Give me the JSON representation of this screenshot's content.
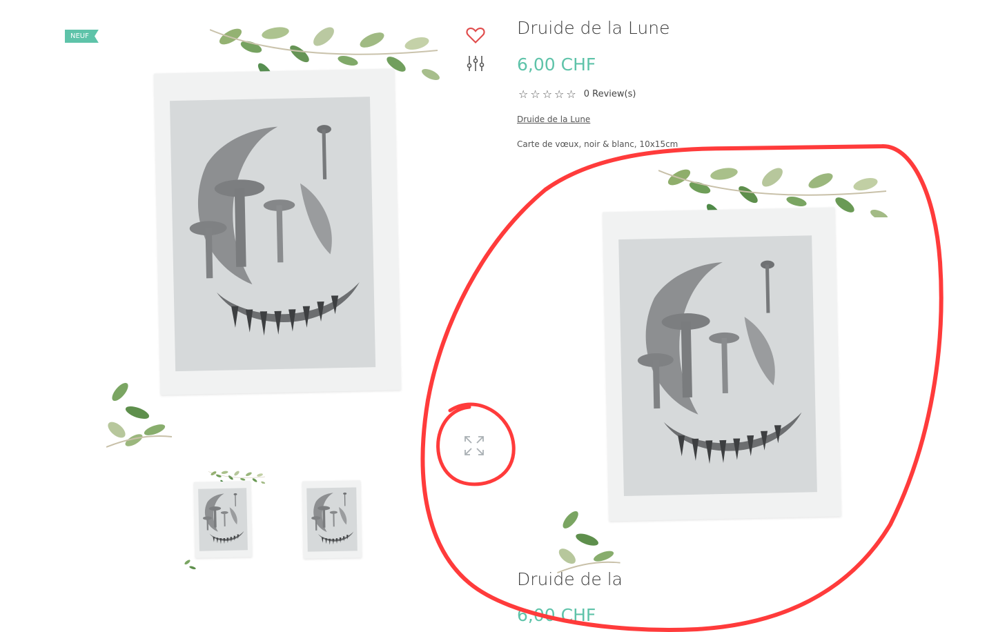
{
  "badge": {
    "label": "NEUF"
  },
  "product": {
    "title": "Druide de la Lune",
    "price": "6,00 CHF",
    "rating": {
      "value": 0,
      "max": 5,
      "reviews_label": "0 Review(s)"
    },
    "link_label": "Druide de la Lune",
    "description": "Carte de vœux, noir & blanc, 10x15cm"
  },
  "zoom_panel": {
    "title": "Druide de la",
    "price": "6,00 CHF"
  },
  "icons": {
    "wishlist": "heart-icon",
    "compare": "sliders-icon",
    "expand": "expand-icon"
  },
  "colors": {
    "accent": "#5ec3a9",
    "wishlist": "#e04b4b",
    "annotation": "#ff3b3b"
  }
}
